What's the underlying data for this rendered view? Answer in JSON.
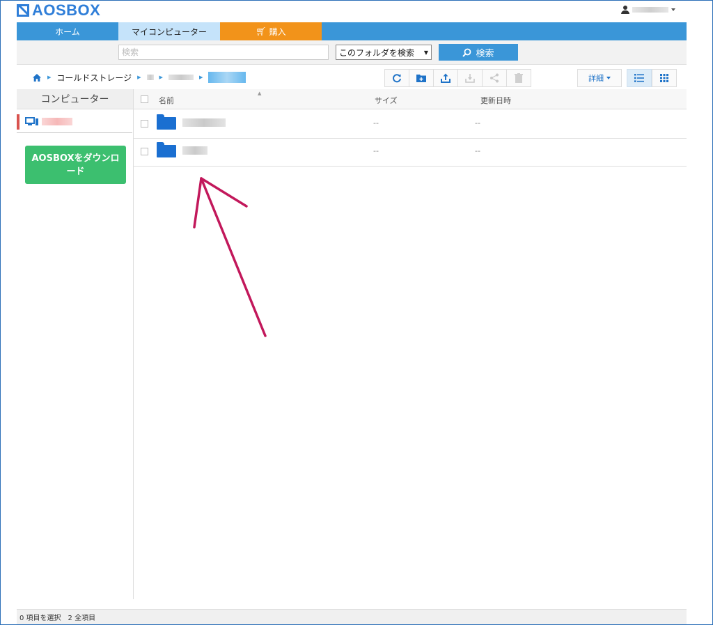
{
  "app": {
    "brand": "AOSBOX"
  },
  "nav": {
    "tabs": [
      {
        "label": "ホーム"
      },
      {
        "label": "マイコンピューター"
      },
      {
        "label": "購入"
      }
    ]
  },
  "search": {
    "placeholder": "検索",
    "scope_label": "このフォルダを検索",
    "button_label": "検索"
  },
  "breadcrumb": {
    "home_icon": "home-icon",
    "items": [
      "コールドストレージ"
    ]
  },
  "toolbar": {
    "icons": [
      "refresh-icon",
      "new-folder-icon",
      "upload-icon",
      "download-icon",
      "share-icon",
      "trash-icon"
    ],
    "detail_label": "詳細",
    "views": [
      "list-view-icon",
      "grid-view-icon"
    ]
  },
  "sidebar": {
    "header": "コンピューター",
    "device_icon": "computer-icon",
    "download_button": "AOSBOXをダウンロード"
  },
  "table": {
    "columns": [
      "名前",
      "サイズ",
      "更新日時"
    ],
    "rows": [
      {
        "size": "--",
        "modified": "--"
      },
      {
        "size": "--",
        "modified": "--"
      }
    ]
  },
  "status": {
    "selected": "0 項目を選択",
    "total": "2 全項目"
  },
  "colors": {
    "accent": "#3a96d8",
    "buy_tab": "#f2931a",
    "download_button": "#3cbf6f",
    "folder": "#1a6fd1",
    "annotation_arrow": "#c2185b"
  }
}
